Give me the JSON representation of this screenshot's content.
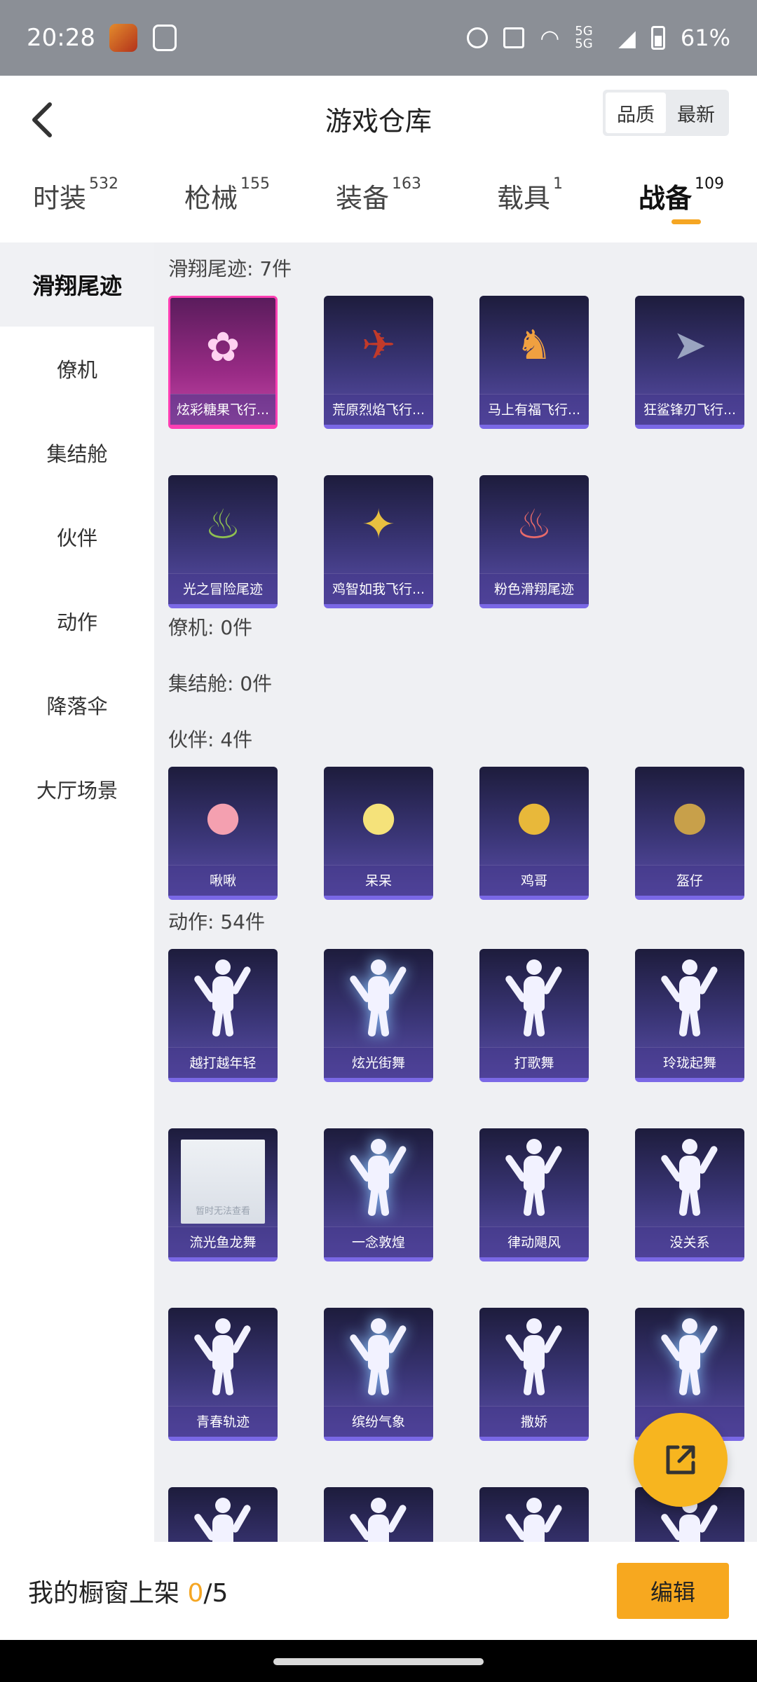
{
  "status_bar": {
    "time": "20:28",
    "network": "5G 5G",
    "battery": "61%"
  },
  "header": {
    "title": "游戏仓库",
    "sort_options": [
      "品质",
      "最新"
    ],
    "sort_selected": "品质"
  },
  "tabs": [
    {
      "label": "时装",
      "count": "532"
    },
    {
      "label": "枪械",
      "count": "155"
    },
    {
      "label": "装备",
      "count": "163"
    },
    {
      "label": "载具",
      "count": "1"
    },
    {
      "label": "战备",
      "count": "109",
      "active": true
    }
  ],
  "sidebar": {
    "items": [
      "滑翔尾迹",
      "僚机",
      "集结舱",
      "伙伴",
      "动作",
      "降落伞",
      "大厅场景"
    ],
    "active": "滑翔尾迹"
  },
  "sections": {
    "glide": {
      "title": "滑翔尾迹: 7件",
      "items": [
        "炫彩糖果飞行...",
        "荒原烈焰飞行...",
        "马上有福飞行...",
        "狂鲨锋刃飞行...",
        "光之冒险尾迹",
        "鸡智如我飞行...",
        "粉色滑翔尾迹"
      ]
    },
    "wingman": {
      "title": "僚机: 0件"
    },
    "capsule": {
      "title": "集结舱: 0件"
    },
    "partner": {
      "title": "伙伴: 4件",
      "items": [
        "啾啾",
        "呆呆",
        "鸡哥",
        "盔仔"
      ]
    },
    "action": {
      "title": "动作: 54件",
      "items": [
        "越打越年轻",
        "炫光街舞",
        "打歌舞",
        "玲珑起舞",
        "流光鱼龙舞",
        "一念敦煌",
        "律动飓风",
        "没关系",
        "青春轨迹",
        "缤纷气象",
        "撒娇",
        ""
      ],
      "placeholder_text": "暂时无法查看"
    }
  },
  "bottom": {
    "showcase_label": "我的橱窗上架",
    "showcase_current": "0",
    "showcase_total": "/5",
    "edit_label": "编辑"
  },
  "colors": {
    "accent": "#f5a623",
    "card_top": "#1d1c3c",
    "card_bottom": "#5a4ea8",
    "rare_border": "#ff3fb3"
  }
}
